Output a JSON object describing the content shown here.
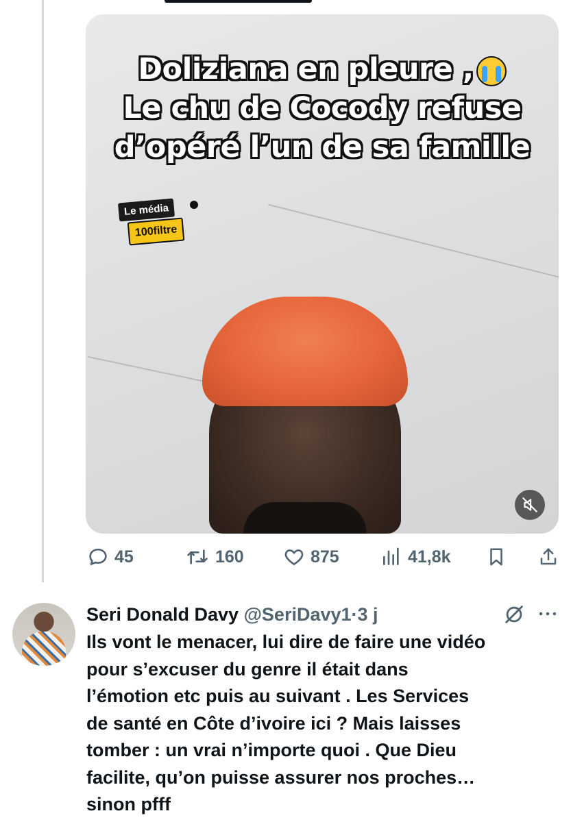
{
  "video": {
    "caption_lines": [
      "Doliziana en pleure ,",
      "Le chu de Cocody refuse",
      "d’opéré l’un de sa famille"
    ],
    "emoji": "crying-face-icon",
    "logo_top": "Le média",
    "logo_bottom": "100filtre",
    "mute_icon": "speaker-muted-icon"
  },
  "actions": {
    "replies": "45",
    "reposts": "160",
    "likes": "875",
    "views": "41,8k"
  },
  "reply": {
    "name": "Seri Donald Davy",
    "handle": "@SeriDavy1",
    "separator": "·",
    "time": "3 j",
    "lines": [
      "Ils vont le menacer, lui dire de faire une vidéo",
      "pour s’excuser du genre il était dans",
      "l’émotion etc puis au suivant . Les Services",
      "de santé en Côte d’ivoire ici ? Mais laisses",
      "tomber : un vrai n’importe quoi . Que Dieu",
      "facilite, qu’on puisse assurer nos proches…",
      "sinon pfff"
    ]
  },
  "colors": {
    "text": "#0f1419",
    "secondary": "#536471",
    "thread_line": "#cfd9de"
  }
}
